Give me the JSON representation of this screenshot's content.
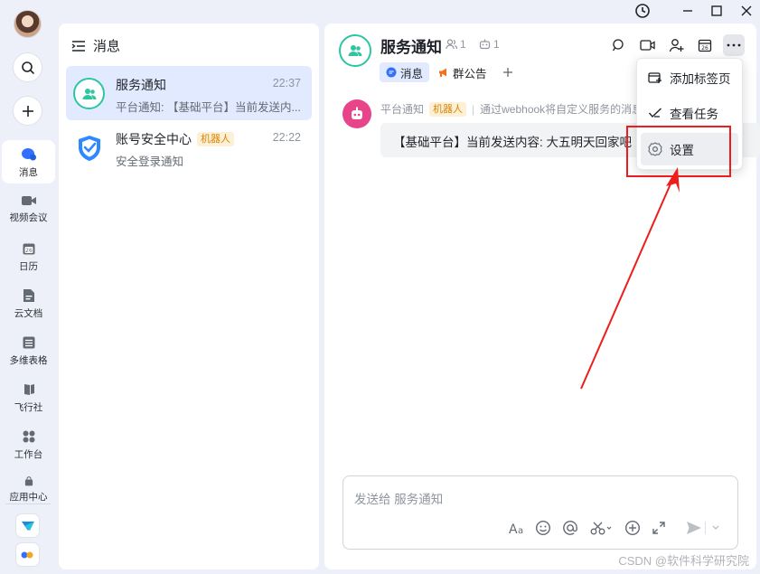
{
  "nav": {
    "items": [
      {
        "label": "消息",
        "icon": "chat-bubble-icon"
      },
      {
        "label": "视频会议",
        "icon": "video-camera-icon"
      },
      {
        "label": "日历",
        "icon": "calendar-icon"
      },
      {
        "label": "云文档",
        "icon": "document-icon"
      },
      {
        "label": "多维表格",
        "icon": "table-grid-icon"
      },
      {
        "label": "飞行社",
        "icon": "flag-icon"
      },
      {
        "label": "工作台",
        "icon": "apps-grid-icon"
      },
      {
        "label": "应用中心",
        "icon": "shopping-bag-icon"
      }
    ]
  },
  "conversation_list": {
    "title": "消息",
    "items": [
      {
        "title": "服务通知",
        "time": "22:37",
        "preview": "平台通知: 【基础平台】当前发送内..."
      },
      {
        "title": "账号安全中心",
        "tag": "机器人",
        "time": "22:22",
        "preview": "安全登录通知"
      }
    ]
  },
  "chat": {
    "title": "服务通知",
    "member_count": "1",
    "bot_count": "1",
    "tabs": [
      {
        "label": "消息"
      },
      {
        "label": "群公告"
      }
    ],
    "message": {
      "sender": "平台通知",
      "sender_tag": "机器人",
      "via": "通过webhook将自定义服务的消息",
      "content": "【基础平台】当前发送内容: 大五明天回家吧"
    },
    "input_placeholder": "发送给 服务通知"
  },
  "menu": {
    "items": [
      {
        "label": "添加标签页"
      },
      {
        "label": "查看任务"
      },
      {
        "label": "设置"
      }
    ]
  },
  "colors": {
    "accent": "#3370ff",
    "selected_bg": "#e1eaff",
    "annotation_red": "#ee1c1c",
    "service_green": "#2cc6a0",
    "bot_pink": "#e8448a"
  },
  "watermark": "CSDN @软件科学研究院"
}
